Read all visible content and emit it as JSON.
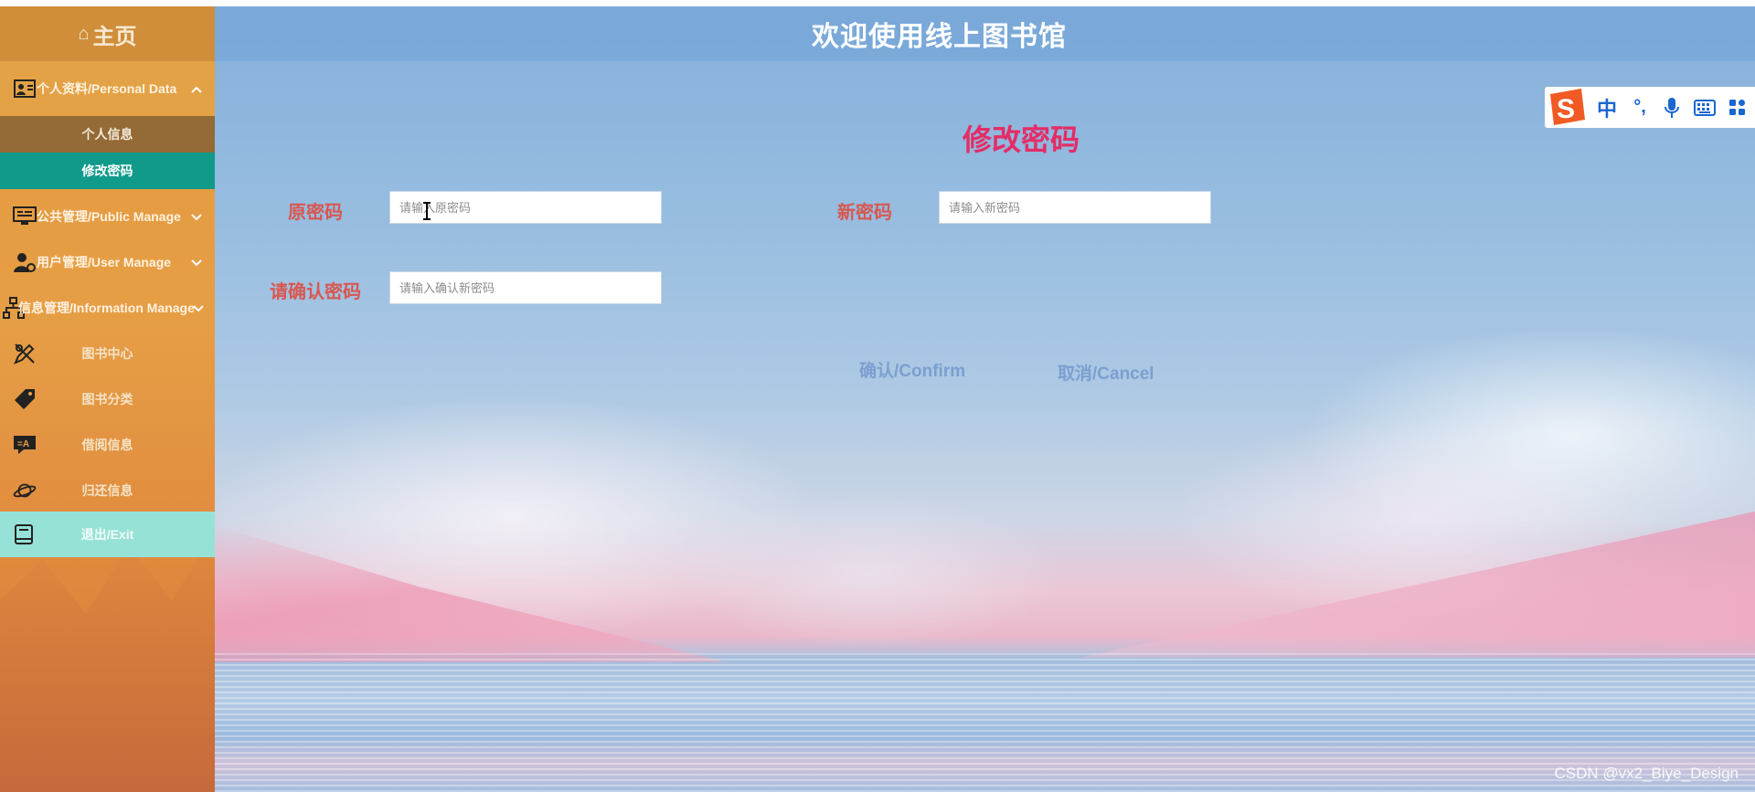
{
  "header": {
    "title": "欢迎使用线上图书馆"
  },
  "sidebar": {
    "home": {
      "icon": "home-icon",
      "label": "主页"
    },
    "groups": [
      {
        "label": "个人资料/Personal Data",
        "icon": "id-card-icon",
        "expanded": true
      },
      {
        "label": "公共管理/Public Manage",
        "icon": "monitor-icon",
        "expanded": false
      },
      {
        "label": "用户管理/User Manage",
        "icon": "user-gear-icon",
        "expanded": false
      },
      {
        "label": "信息管理/Information Manage",
        "icon": "sitemap-icon",
        "expanded": false
      }
    ],
    "submenu": [
      {
        "label": "个人信息"
      },
      {
        "label": "修改密码",
        "active": true
      }
    ],
    "items": [
      {
        "label": "图书中心",
        "icon": "design-tools-icon"
      },
      {
        "label": "图书分类",
        "icon": "tags-icon"
      },
      {
        "label": "借阅信息",
        "icon": "translate-chat-icon"
      },
      {
        "label": "归还信息",
        "icon": "planet-icon"
      },
      {
        "label": "退出/Exit",
        "icon": "book-icon"
      }
    ]
  },
  "form": {
    "title": "修改密码",
    "old_password": {
      "label": "原密码",
      "placeholder": "请输入原密码",
      "value": ""
    },
    "new_password": {
      "label": "新密码",
      "placeholder": "请输入新密码",
      "value": ""
    },
    "confirm_password": {
      "label": "请确认密码",
      "placeholder": "请输入确认新密码",
      "value": ""
    },
    "confirm_button": "确认/Confirm",
    "cancel_button": "取消/Cancel"
  },
  "ime": {
    "logo": "S",
    "mode": "中",
    "punct": "°,",
    "mic": "microphone-icon",
    "keyboard": "keyboard-icon",
    "apps": "apps-grid-icon"
  },
  "watermark": "CSDN @vx2_Biye_Design",
  "colors": {
    "sidebar": "#e39a40",
    "submenu_active": "#0f9a8a",
    "submenu_parent": "#946a36",
    "exit_highlight": "#96e2d6",
    "header": "#7aa8d8",
    "form_title": "#e52c66",
    "field_label": "#d9574f",
    "button_text": "#7c9fd0"
  }
}
